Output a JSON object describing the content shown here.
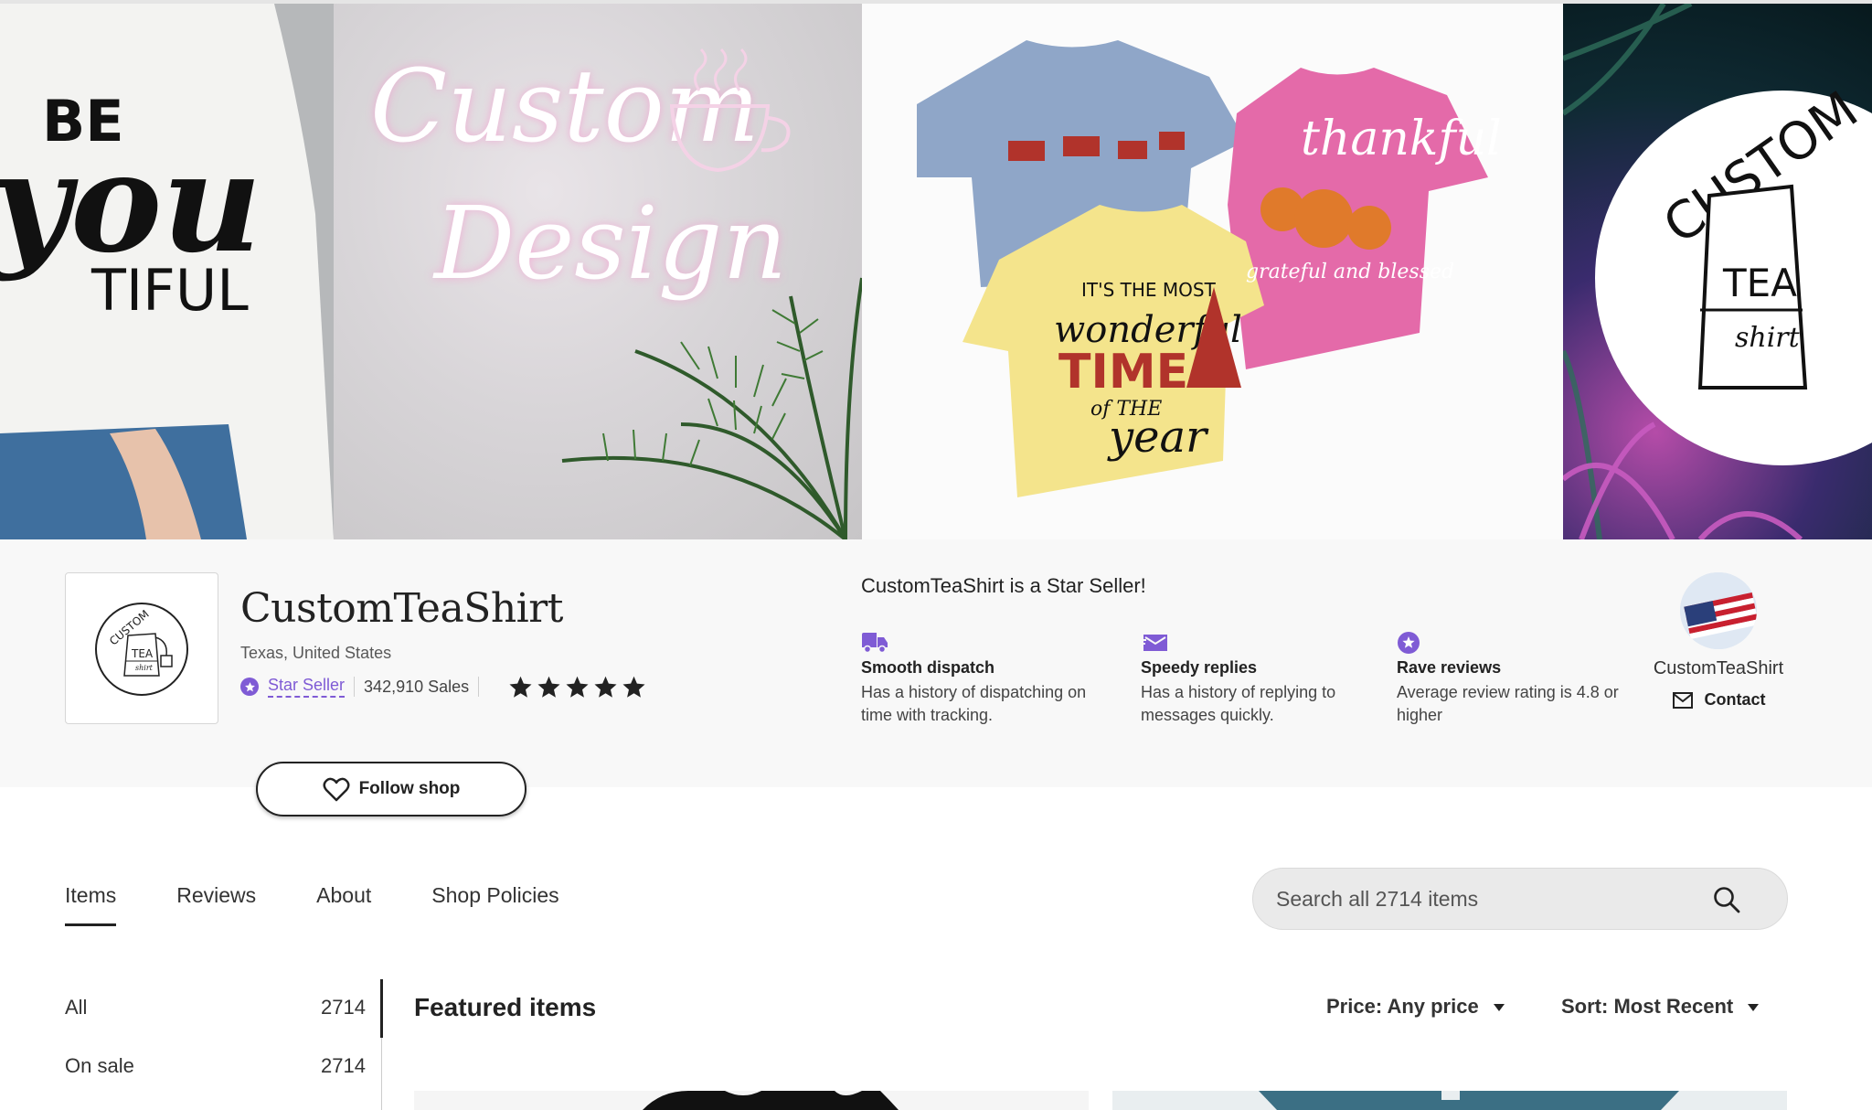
{
  "banner": {
    "panel1_text": [
      "BE",
      "you",
      "TIFUL"
    ],
    "panel2_text": [
      "Custom",
      "Design"
    ],
    "panel3_text": [
      "thankful",
      "grateful and blessed",
      "IT'S THE MOST",
      "wonderful",
      "TIME",
      "of THE",
      "year"
    ],
    "panel4_text": [
      "CUSTOM",
      "TEA",
      "shirt"
    ]
  },
  "logo_text": [
    "CUSTOM",
    "TEA",
    "shirt"
  ],
  "shop": {
    "name": "CustomTeaShirt",
    "location": "Texas, United States",
    "star_seller_label": "Star Seller",
    "sales": "342,910 Sales",
    "rating_stars": 5
  },
  "star_seller_section": {
    "title": "CustomTeaShirt is a Star Seller!",
    "features": [
      {
        "icon": "truck-icon",
        "title": "Smooth dispatch",
        "desc": "Has a history of dispatching on time with tracking."
      },
      {
        "icon": "message-icon",
        "title": "Speedy replies",
        "desc": "Has a history of replying to messages quickly."
      },
      {
        "icon": "star-badge-icon",
        "title": "Rave reviews",
        "desc": "Average review rating is 4.8 or higher"
      }
    ]
  },
  "owner": {
    "name": "CustomTeaShirt",
    "contact_label": "Contact"
  },
  "follow_label": "Follow shop",
  "tabs": [
    {
      "label": "Items",
      "active": true
    },
    {
      "label": "Reviews",
      "active": false
    },
    {
      "label": "About",
      "active": false
    },
    {
      "label": "Shop Policies",
      "active": false
    }
  ],
  "search": {
    "placeholder": "Search all 2714 items"
  },
  "sidebar": {
    "items": [
      {
        "label": "All",
        "count": "2714"
      },
      {
        "label": "On sale",
        "count": "2714"
      }
    ]
  },
  "main": {
    "featured_title": "Featured items",
    "price_filter": "Price: Any price",
    "sort": "Sort: Most Recent"
  },
  "colors": {
    "accent_purple": "#7f5bd5",
    "text_dark": "#222222",
    "header_bg": "#f8f8f8"
  }
}
